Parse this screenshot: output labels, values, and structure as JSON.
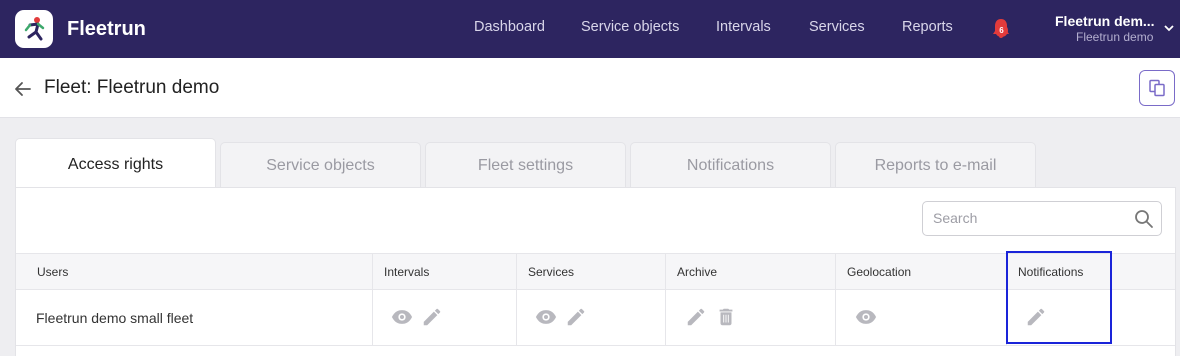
{
  "app": {
    "brand": "Fleetrun"
  },
  "nav": [
    "Dashboard",
    "Service objects",
    "Intervals",
    "Services",
    "Reports"
  ],
  "notifications": {
    "count": "6"
  },
  "account": {
    "name": "Fleetrun dem...",
    "sub": "Fleetrun demo"
  },
  "page": {
    "title": "Fleet: Fleetrun demo"
  },
  "tabs": [
    "Access rights",
    "Service objects",
    "Fleet settings",
    "Notifications",
    "Reports to e-mail"
  ],
  "active_tab": "Access rights",
  "search": {
    "placeholder": "Search",
    "value": ""
  },
  "table": {
    "columns": [
      "Users",
      "Intervals",
      "Services",
      "Archive",
      "Geolocation",
      "Notifications"
    ],
    "rows": [
      {
        "user": "Fleetrun demo small fleet",
        "intervals": [
          "eye-icon",
          "pencil-icon"
        ],
        "services": [
          "eye-icon",
          "pencil-icon"
        ],
        "archive": [
          "pencil-icon",
          "trash-icon"
        ],
        "geolocation": [
          "eye-icon"
        ],
        "notifications": [
          "pencil-icon"
        ]
      }
    ]
  },
  "colors": {
    "topbar": "#2d2560",
    "accent": "#7a6bc8",
    "highlight": "#1a24d9",
    "badge": "#e23b3b",
    "icon": "#b8b8be"
  }
}
